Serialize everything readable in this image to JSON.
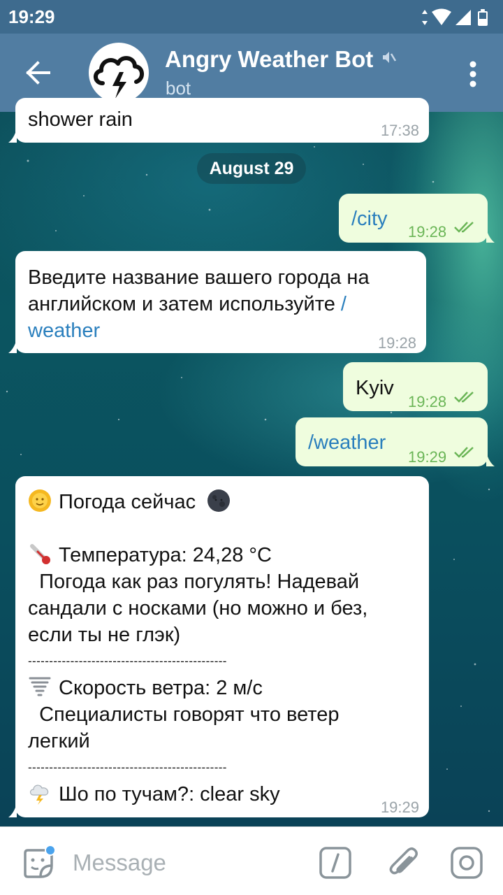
{
  "status_bar": {
    "time": "19:29"
  },
  "header": {
    "title": "Angry Weather Bot",
    "subtitle": "bot",
    "icons": [
      "back-arrow-icon",
      "storm-cloud-avatar",
      "mute-icon",
      "more-vert-icon"
    ]
  },
  "colors": {
    "header": "#517da2",
    "status_bar": "#3e6b8e",
    "outgoing_bubble": "#effdde",
    "incoming_bubble": "#ffffff",
    "link": "#2a7fbd",
    "check": "#6ab556"
  },
  "messages": {
    "m0": {
      "text": "shower rain",
      "time": "17:38",
      "direction": "in"
    },
    "date_divider": "August 29",
    "m1": {
      "text": "/city",
      "time": "19:28",
      "direction": "out",
      "read": true
    },
    "m2": {
      "line1": "Введите название вашего города на",
      "line2a": "английском и затем используйте ",
      "line2b": "/",
      "line3": "weather",
      "time": "19:28",
      "direction": "in"
    },
    "m3": {
      "text": "Kyiv",
      "time": "19:28",
      "direction": "out",
      "read": true
    },
    "m4": {
      "text": "/weather",
      "time": "19:29",
      "direction": "out",
      "read": true
    },
    "m5": {
      "heading": "Погода сейчас",
      "temp": "Температура: 24,28 °C",
      "temp_note_l1": "  Погода как раз погулять! Надевай",
      "temp_note_l2": "сандали с носками (но можно и без,",
      "temp_note_l3": "если ты не глэк)",
      "divider": "-----------------------------------------------",
      "wind": "Скорость ветра: 2 м/с",
      "wind_note_l1": "  Специалисты говорят что ветер",
      "wind_note_l2": "легкий",
      "clouds": "Шо по тучам?: clear sky",
      "time": "19:29",
      "direction": "in",
      "emojis": [
        "sun-face-icon",
        "new-moon-face-icon",
        "thermometer-icon",
        "tornado-icon",
        "cloud-lightning-icon"
      ]
    }
  },
  "input": {
    "placeholder": "Message",
    "icons": [
      "sticker-icon",
      "bot-command-icon",
      "paperclip-icon",
      "camera-icon"
    ]
  }
}
